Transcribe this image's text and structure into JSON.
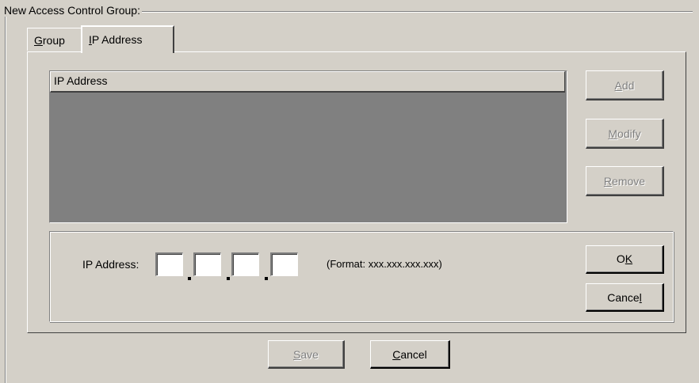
{
  "group": {
    "title": "New  Access Control Group:"
  },
  "tabs": {
    "group": {
      "mnemonic": "G",
      "rest": "roup"
    },
    "ip_address": {
      "mnemonic": "I",
      "rest": "P Address"
    }
  },
  "list": {
    "column_header": "IP Address",
    "rows": []
  },
  "side_buttons": {
    "add": {
      "mnemonic": "A",
      "rest": "dd",
      "enabled": false
    },
    "modify": {
      "mnemonic": "M",
      "rest": "odify",
      "enabled": false
    },
    "remove": {
      "mnemonic": "R",
      "rest": "emove",
      "enabled": false
    }
  },
  "ip_entry": {
    "label": "IP Address:",
    "octets": [
      "",
      "",
      "",
      ""
    ],
    "format_hint": "(Format: xxx.xxx.xxx.xxx)"
  },
  "ip_buttons": {
    "ok": {
      "pre": "O",
      "mnemonic": "K",
      "enabled": true
    },
    "cancel": {
      "pre": "Cance",
      "mnemonic": "l",
      "enabled": true
    }
  },
  "footer": {
    "save": {
      "mnemonic": "S",
      "rest": "ave",
      "enabled": false
    },
    "cancel": {
      "mnemonic": "C",
      "rest": "ancel",
      "enabled": true
    }
  }
}
